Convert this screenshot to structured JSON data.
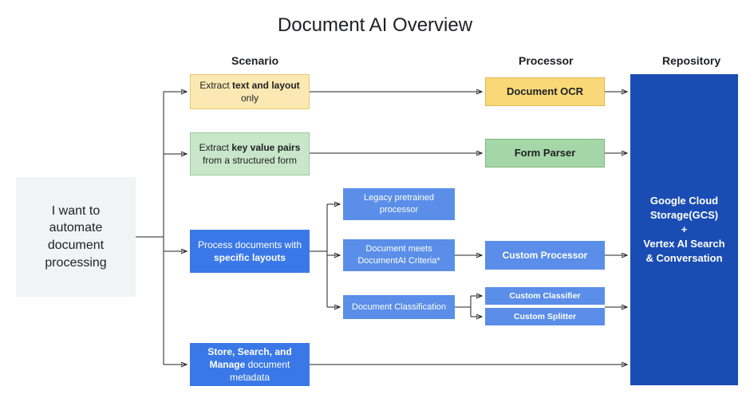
{
  "title": "Document AI Overview",
  "headers": {
    "scenario": "Scenario",
    "processor": "Processor",
    "repository": "Repository"
  },
  "start": "I want to automate document processing",
  "scenarios": {
    "text_layout_pre": "Extract ",
    "text_layout_bold": "text and layout",
    "text_layout_post": " only",
    "kv_pre": "Extract ",
    "kv_bold": "key value pairs",
    "kv_post": " from a structured form",
    "layouts_pre": "Process documents with ",
    "layouts_bold": "specific layouts",
    "layouts_post": "",
    "store_pre": "Store, Search, and Manage",
    "store_post": " document metadata"
  },
  "sub": {
    "legacy": "Legacy pretrained processor",
    "criteria": "Document meets DocumentAI Criteria*",
    "classification": "Document Classification"
  },
  "processors": {
    "ocr": "Document OCR",
    "form": "Form Parser",
    "custom": "Custom Processor",
    "classifier": "Custom Classifier",
    "splitter": "Custom Splitter"
  },
  "repo_lines": {
    "l1": "Google Cloud Storage(GCS)",
    "l2": "+",
    "l3": "Vertex AI Search & Conversation"
  }
}
